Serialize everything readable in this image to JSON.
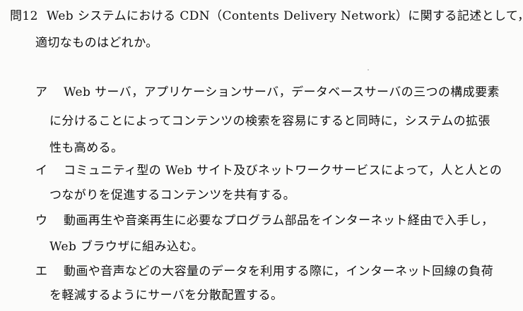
{
  "question": {
    "number": "問12",
    "line1": "Web システムにおける CDN（Contents Delivery Network）に関する記述として，",
    "line2": "適切なものはどれか。"
  },
  "options": [
    {
      "label": "ア",
      "lines": [
        "Web サーバ，アプリケーションサーバ，データベースサーバの三つの構成要素",
        "に分けることによってコンテンツの検索を容易にすると同時に，システムの拡張",
        "性も高める。"
      ]
    },
    {
      "label": "イ",
      "lines": [
        "コミュニティ型の Web サイト及びネットワークサービスによって，人と人との",
        "つながりを促進するコンテンツを共有する。"
      ]
    },
    {
      "label": "ウ",
      "lines": [
        "動画再生や音楽再生に必要なプログラム部品をインターネット経由で入手し，",
        "Web ブラウザに組み込む。"
      ]
    },
    {
      "label": "エ",
      "lines": [
        "動画や音声などの大容量のデータを利用する際に，インターネット回線の負荷",
        "を軽減するようにサーバを分散配置する。"
      ]
    }
  ]
}
